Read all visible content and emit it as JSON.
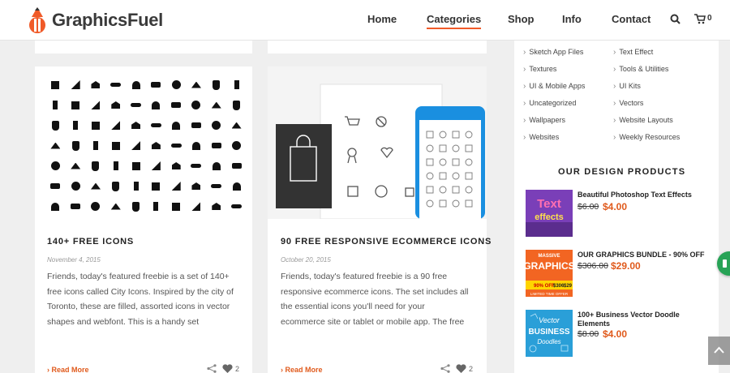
{
  "site": {
    "logo_text": "GraphicsFuel",
    "accent_color": "#f05a28",
    "price_color": "#e05a1c"
  },
  "nav": {
    "items": [
      {
        "label": "Home"
      },
      {
        "label": "Categories",
        "active": true
      },
      {
        "label": "Shop"
      },
      {
        "label": "Info"
      },
      {
        "label": "Contact"
      }
    ],
    "search_icon": "search-icon",
    "cart_icon": "cart-icon",
    "cart_count": "0"
  },
  "posts": [
    {
      "title": "140+ FREE ICONS",
      "date": "November 4, 2015",
      "excerpt": [
        "Friends, today's featured freebie is a set of 140+",
        "free icons called City Icons. Inspired by the city of",
        "Toronto, these are filled, assorted icons in vector",
        "shapes and webfont. This is a handy set"
      ],
      "read_more": "Read More",
      "likes": "2"
    },
    {
      "title": "90 FREE RESPONSIVE ECOMMERCE ICONS",
      "date": "October 20, 2015",
      "excerpt": [
        "Friends, today's featured freebie is a 90 free",
        "responsive ecommerce icons. The set includes all",
        "the essential icons you'll need for your",
        "ecommerce site or tablet or mobile app. The free"
      ],
      "read_more": "Read More",
      "likes": "2"
    }
  ],
  "sidebar": {
    "categories_left": [
      "Sketch App Files",
      "Textures",
      "UI & Mobile Apps",
      "Uncategorized",
      "Wallpapers",
      "Websites"
    ],
    "categories_right": [
      "Text Effect",
      "Tools & Utilities",
      "UI Kits",
      "Vectors",
      "Website Layouts",
      "Weekly Resources"
    ],
    "products_heading": "OUR DESIGN PRODUCTS",
    "products": [
      {
        "name": "Beautiful Photoshop Text Effects",
        "old_price": "$6.00",
        "new_price": "$4.00",
        "thumb_words": [
          "Text",
          "effects"
        ]
      },
      {
        "name": "OUR GRAPHICS BUNDLE - 90% OFF",
        "old_price": "$306.00",
        "new_price": "$29.00",
        "thumb_words": [
          "MASSIVE",
          "GRAPHICS",
          "90% OFF",
          "$306",
          "$29",
          "LIMITED TIME OFFER"
        ]
      },
      {
        "name": "100+ Business Vector Doodle Elements",
        "old_price": "$8.00",
        "new_price": "$4.00",
        "thumb_words": [
          "Vector",
          "BUSINESS",
          "Doodles"
        ]
      }
    ]
  }
}
